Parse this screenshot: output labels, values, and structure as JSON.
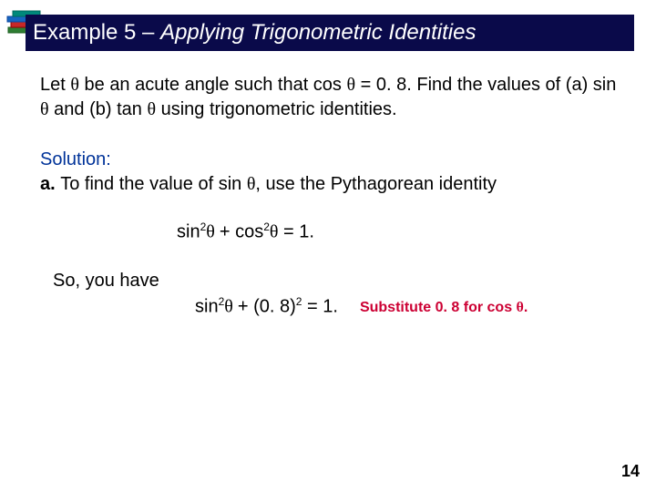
{
  "icon": "books-icon",
  "title": {
    "prefix": "Example 5 – ",
    "main": "Applying Trigonometric Identities"
  },
  "problem": {
    "p1a": "Let ",
    "theta1": "θ",
    "p1b": " be an acute angle such that cos ",
    "theta2": "θ",
    "p1c": " = 0. 8. Find the values of (a) sin ",
    "theta3": "θ",
    "p1d": " and (b) tan ",
    "theta4": "θ",
    "p1e": " using trigonometric identities."
  },
  "solution": {
    "label": "Solution:",
    "a_line_a": "a. ",
    "a_line_b": "To find the value of sin ",
    "theta5": "θ",
    "a_line_c": ", use the Pythagorean identity"
  },
  "identity": {
    "lhs1": "sin",
    "sup": "2",
    "theta6": "θ ",
    "plus": " + cos",
    "theta7": "θ",
    "eq": " = 1."
  },
  "so_you_have": "So, you have",
  "eq2": {
    "lhs1": "sin",
    "sup": "2",
    "theta8": "θ ",
    "plus": " + (0. 8)",
    "sup2": "2",
    "eq": " = 1."
  },
  "note": {
    "a": "Substitute 0. 8 for cos ",
    "theta9": "θ",
    "b": "."
  },
  "page": "14"
}
